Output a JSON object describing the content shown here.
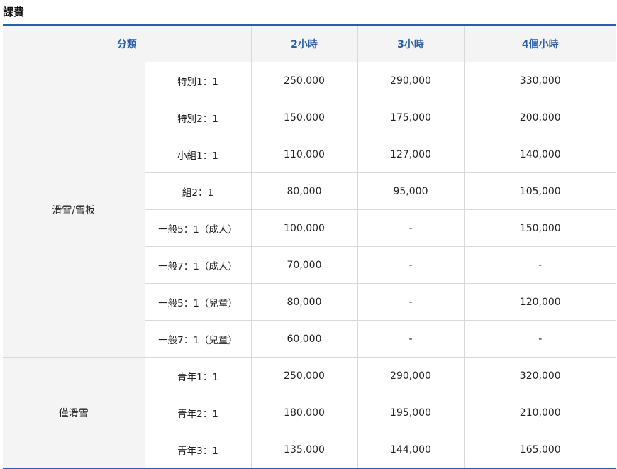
{
  "title": "課費",
  "header": {
    "category": "分類",
    "h2": "2小時",
    "h3": "3小時",
    "h4": "4個小時"
  },
  "groups": [
    {
      "name": "滑雪/雪板",
      "rows": [
        {
          "type": "特別1：1",
          "h2": "250,000",
          "h3": "290,000",
          "h4": "330,000"
        },
        {
          "type": "特別2：1",
          "h2": "150,000",
          "h3": "175,000",
          "h4": "200,000"
        },
        {
          "type": "小組1：1",
          "h2": "110,000",
          "h3": "127,000",
          "h4": "140,000"
        },
        {
          "type": "組2：1",
          "h2": "80,000",
          "h3": "95,000",
          "h4": "105,000"
        },
        {
          "type": "一般5：1（成人）",
          "h2": "100,000",
          "h3": "-",
          "h4": "150,000"
        },
        {
          "type": "一般7：1（成人）",
          "h2": "70,000",
          "h3": "-",
          "h4": "-"
        },
        {
          "type": "一般5：1（兒童）",
          "h2": "80,000",
          "h3": "-",
          "h4": "120,000"
        },
        {
          "type": "一般7：1（兒童）",
          "h2": "60,000",
          "h3": "-",
          "h4": "-"
        }
      ]
    },
    {
      "name": "僅滑雪",
      "rows": [
        {
          "type": "青年1：1",
          "h2": "250,000",
          "h3": "290,000",
          "h4": "320,000"
        },
        {
          "type": "青年2：1",
          "h2": "180,000",
          "h3": "195,000",
          "h4": "210,000"
        },
        {
          "type": "青年3：1",
          "h2": "135,000",
          "h3": "144,000",
          "h4": "165,000"
        }
      ]
    }
  ]
}
